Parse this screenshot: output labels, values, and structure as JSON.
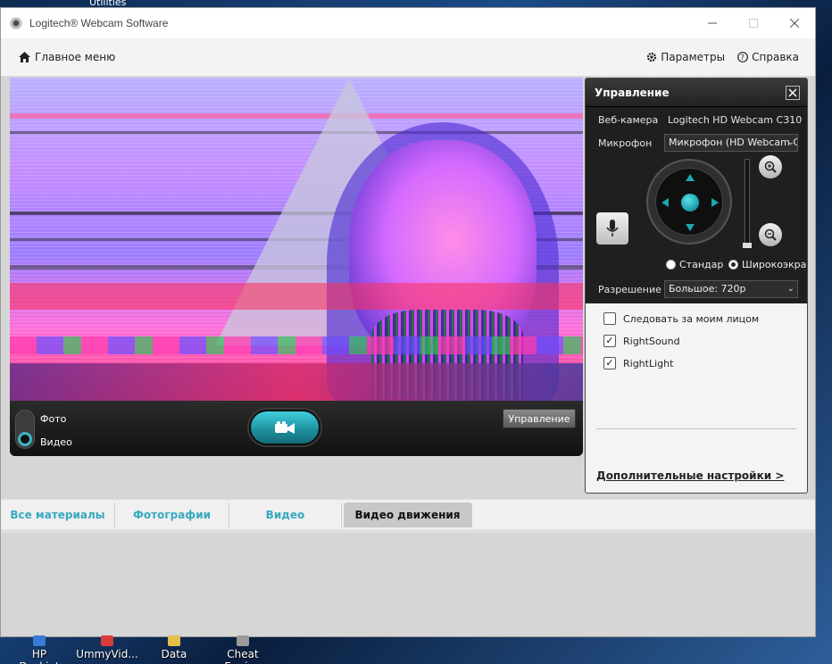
{
  "desktop": {
    "top_text": "Utilities",
    "icons": [
      {
        "label": "HP Deskjet",
        "color": "#3a7bd5"
      },
      {
        "label": "UmmyVid...",
        "color": "#d93a3a"
      },
      {
        "label": "Data",
        "color": "#e7c04a"
      },
      {
        "label": "Cheat Engine",
        "color": "#9a9a9a"
      }
    ]
  },
  "window": {
    "title": "Logitech® Webcam Software",
    "minimize_icon": "minimize-icon",
    "maximize_icon": "maximize-icon",
    "close_icon": "close-icon"
  },
  "nav": {
    "home_label": "Главное меню",
    "settings_label": "Параметры",
    "help_label": "Справка"
  },
  "video": {
    "mode_photo": "Фото",
    "mode_video": "Видео",
    "control_button": "Управление",
    "record_icon": "video-camera-icon"
  },
  "control_panel": {
    "title": "Управление",
    "webcam_label": "Веб-камера",
    "webcam_value": "Logitech HD Webcam C310",
    "mic_label": "Микрофон",
    "mic_value": "Микрофон (HD Webcam C",
    "view_standard": "Стандар",
    "view_wide": "Широкоэкра",
    "resolution_label": "Разрешение",
    "resolution_value": "Большое: 720p",
    "accent": "#1ea5b0",
    "checks": [
      {
        "label": "Следовать за моим лицом",
        "checked": false
      },
      {
        "label": "RightSound",
        "checked": true
      },
      {
        "label": "RightLight",
        "checked": true
      }
    ],
    "advanced_link": "Дополнительные настройки >"
  },
  "tabs": [
    {
      "label": "Все материалы",
      "active": false
    },
    {
      "label": "Фотографии",
      "active": false
    },
    {
      "label": "Видео",
      "active": false
    },
    {
      "label": "Видео движения",
      "active": true
    }
  ]
}
